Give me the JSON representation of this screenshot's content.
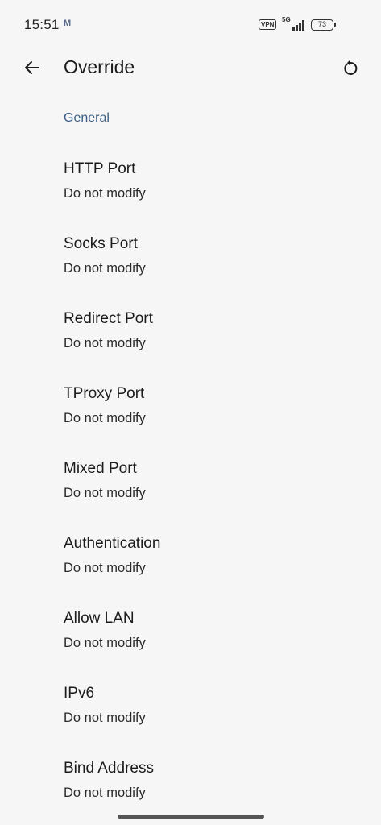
{
  "status_bar": {
    "time": "15:51",
    "app_icon_glyph": "M",
    "vpn": "VPN",
    "network": "5G",
    "battery": "73"
  },
  "app_bar": {
    "title": "Override",
    "back_icon": "arrow-back-icon",
    "reset_icon": "reset-icon"
  },
  "section": {
    "header": "General"
  },
  "settings": [
    {
      "title": "HTTP Port",
      "value": "Do not modify"
    },
    {
      "title": "Socks Port",
      "value": "Do not modify"
    },
    {
      "title": "Redirect Port",
      "value": "Do not modify"
    },
    {
      "title": "TProxy Port",
      "value": "Do not modify"
    },
    {
      "title": "Mixed Port",
      "value": "Do not modify"
    },
    {
      "title": "Authentication",
      "value": "Do not modify"
    },
    {
      "title": "Allow LAN",
      "value": "Do not modify"
    },
    {
      "title": "IPv6",
      "value": "Do not modify"
    },
    {
      "title": "Bind Address",
      "value": "Do not modify"
    }
  ],
  "colors": {
    "background": "#f6f6f6",
    "section_header": "#3b5f85",
    "text_primary": "#1b1b1b"
  }
}
